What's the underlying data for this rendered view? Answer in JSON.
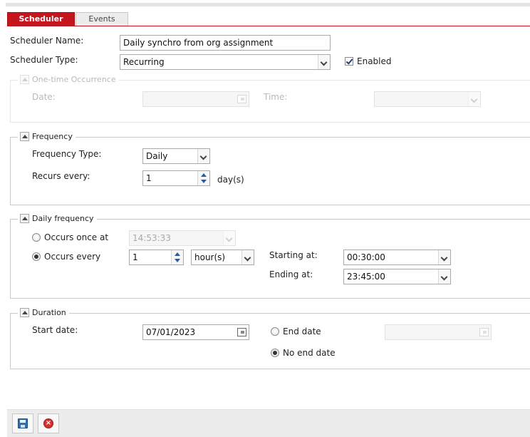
{
  "tabs": [
    {
      "label": "Scheduler",
      "active": true
    },
    {
      "label": "Events",
      "active": false
    }
  ],
  "form": {
    "scheduler_name_label": "Scheduler Name:",
    "scheduler_name_value": "Daily synchro from org assignment",
    "scheduler_type_label": "Scheduler Type:",
    "scheduler_type_value": "Recurring",
    "enabled_label": "Enabled",
    "enabled_checked": true
  },
  "one_time": {
    "legend": "One-time Occurrence",
    "date_label": "Date:",
    "time_label": "Time:",
    "date_value": "",
    "time_value": ""
  },
  "frequency": {
    "legend": "Frequency",
    "type_label": "Frequency Type:",
    "type_value": "Daily",
    "recurs_label": "Recurs every:",
    "recurs_value": "1",
    "recurs_unit": "day(s)"
  },
  "daily_frequency": {
    "legend": "Daily frequency",
    "once_label": "Occurs once at",
    "once_value": "14:53:33",
    "every_label": "Occurs every",
    "every_value": "1",
    "every_unit": "hour(s)",
    "selected": "every",
    "starting_label": "Starting at:",
    "starting_value": "00:30:00",
    "ending_label": "Ending at:",
    "ending_value": "23:45:00"
  },
  "duration": {
    "legend": "Duration",
    "start_label": "Start date:",
    "start_value": "07/01/2023",
    "end_date_label": "End date",
    "end_date_value": "",
    "no_end_label": "No end date",
    "selected": "no_end"
  },
  "toolbar": {
    "save_icon": "save-icon",
    "cancel_icon": "cancel-icon"
  },
  "colors": {
    "accent": "#c4161c",
    "radio_checked": "#333333",
    "icon_blue": "#2f6fb6",
    "cancel_red": "#d63030"
  }
}
